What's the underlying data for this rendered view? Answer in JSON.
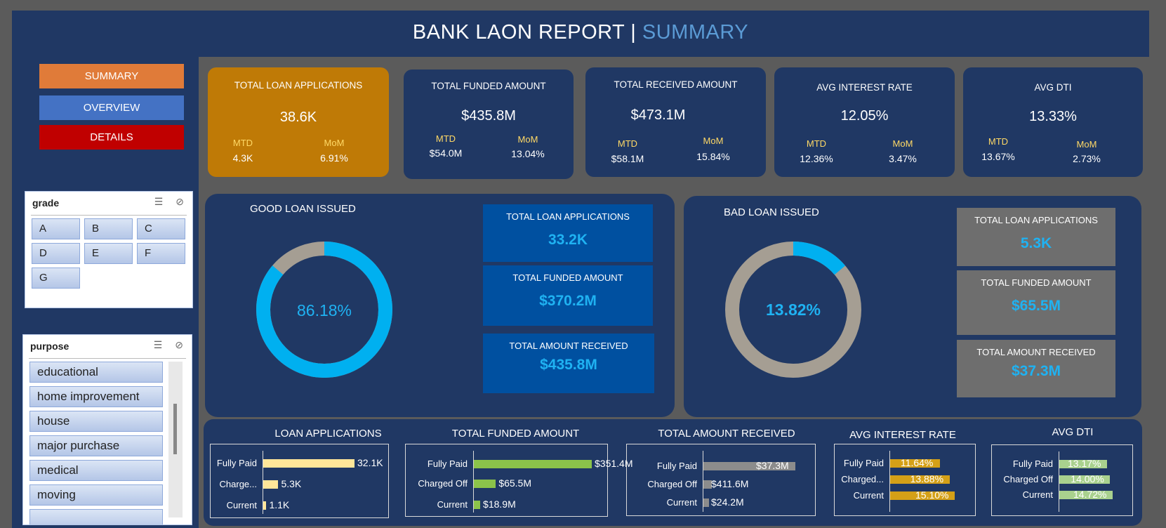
{
  "header": {
    "title_main": "BANK LAON REPORT | ",
    "title_sub": "SUMMARY"
  },
  "nav": {
    "summary": "SUMMARY",
    "overview": "OVERVIEW",
    "details": "DETAILS"
  },
  "colors": {
    "summary": "#e07b39",
    "overview": "#4472c4",
    "details": "#c00000",
    "navy": "#203864",
    "accent": "#1fb2f2",
    "grey": "#a59e93",
    "bar_yellow": "#ffe699",
    "bar_green": "#8bc34a",
    "bar_gold": "#d4a017",
    "bar_grey": "#8c8c8c",
    "bar_lightgreen": "#a9d18e"
  },
  "grade_slicer": {
    "title": "grade",
    "items": [
      "A",
      "B",
      "C",
      "D",
      "E",
      "F",
      "G"
    ]
  },
  "purpose_slicer": {
    "title": "purpose",
    "items": [
      "educational",
      "home improvement",
      "house",
      "major purchase",
      "medical",
      "moving"
    ]
  },
  "kpis": [
    {
      "label": "TOTAL LOAN APPLICATIONS",
      "value": "38.6K",
      "mtd_label": "MTD",
      "mtd": "4.3K",
      "mom_label": "MoM",
      "mom": "6.91%"
    },
    {
      "label": "TOTAL FUNDED AMOUNT",
      "value": "$435.8M",
      "mtd_label": "MTD",
      "mtd": "$54.0M",
      "mom_label": "MoM",
      "mom": "13.04%"
    },
    {
      "label": "TOTAL RECEIVED AMOUNT",
      "value": "$473.1M",
      "mtd_label": "MTD",
      "mtd": "$58.1M",
      "mom_label": "MoM",
      "mom": "15.84%"
    },
    {
      "label": "AVG INTEREST RATE",
      "value": "12.05%",
      "mtd_label": "MTD",
      "mtd": "12.36%",
      "mom_label": "MoM",
      "mom": "3.47%"
    },
    {
      "label": "AVG DTI",
      "value": "13.33%",
      "mtd_label": "MTD",
      "mtd": "13.67%",
      "mom_label": "MoM",
      "mom": "2.73%"
    }
  ],
  "good_loan": {
    "title": "GOOD LOAN ISSUED",
    "percent_label": "86.18%",
    "percent": 86.18,
    "stats": [
      {
        "label": "TOTAL LOAN APPLICATIONS",
        "value": "33.2K"
      },
      {
        "label": "TOTAL  FUNDED AMOUNT",
        "value": "$370.2M"
      },
      {
        "label": "TOTAL  AMOUNT RECEIVED",
        "value": "$435.8M"
      }
    ]
  },
  "bad_loan": {
    "title": "BAD LOAN ISSUED",
    "percent_label": "13.82%",
    "percent": 13.82,
    "stats": [
      {
        "label": "TOTAL LOAN APPLICATIONS",
        "value": "5.3K"
      },
      {
        "label": "TOTAL  FUNDED AMOUNT",
        "value": "$65.5M"
      },
      {
        "label": "TOTAL  AMOUNT RECEIVED",
        "value": "$37.3M"
      }
    ]
  },
  "chart_data": [
    {
      "type": "bar",
      "title": "LOAN APPLICATIONS",
      "categories": [
        "Fully Paid",
        "Charge...",
        "Current"
      ],
      "values": [
        32.1,
        5.3,
        1.1
      ],
      "labels": [
        "32.1K",
        "5.3K",
        "1.1K"
      ],
      "max": 32.1
    },
    {
      "type": "bar",
      "title": "TOTAL FUNDED AMOUNT",
      "categories": [
        "Fully Paid",
        "Charged Off",
        "Current"
      ],
      "values": [
        351.4,
        65.5,
        18.9
      ],
      "labels": [
        "$351.4M",
        "$65.5M",
        "$18.9M"
      ],
      "max": 351.4
    },
    {
      "type": "bar",
      "title": "TOTAL AMOUNT RECEIVED",
      "categories": [
        "Fully Paid",
        "Charged Off",
        "Current"
      ],
      "values": [
        411.6,
        37.3,
        24.2
      ],
      "labels": [
        "$37.3M",
        "$411.6M",
        "$24.2M"
      ],
      "max": 411.6
    },
    {
      "type": "bar",
      "title": "AVG INTEREST  RATE",
      "categories": [
        "Fully Paid",
        "Charged...",
        "Current"
      ],
      "values": [
        11.64,
        13.88,
        15.1
      ],
      "labels": [
        "11.64%",
        "13.88%",
        "15.10%"
      ],
      "max": 15.1
    },
    {
      "type": "bar",
      "title": "AVG DTI",
      "categories": [
        "Fully Paid",
        "Charged Off",
        "Current"
      ],
      "values": [
        13.17,
        14.0,
        14.72
      ],
      "labels": [
        "13.17%",
        "14.00%",
        "14.72%"
      ],
      "max": 14.72
    }
  ]
}
